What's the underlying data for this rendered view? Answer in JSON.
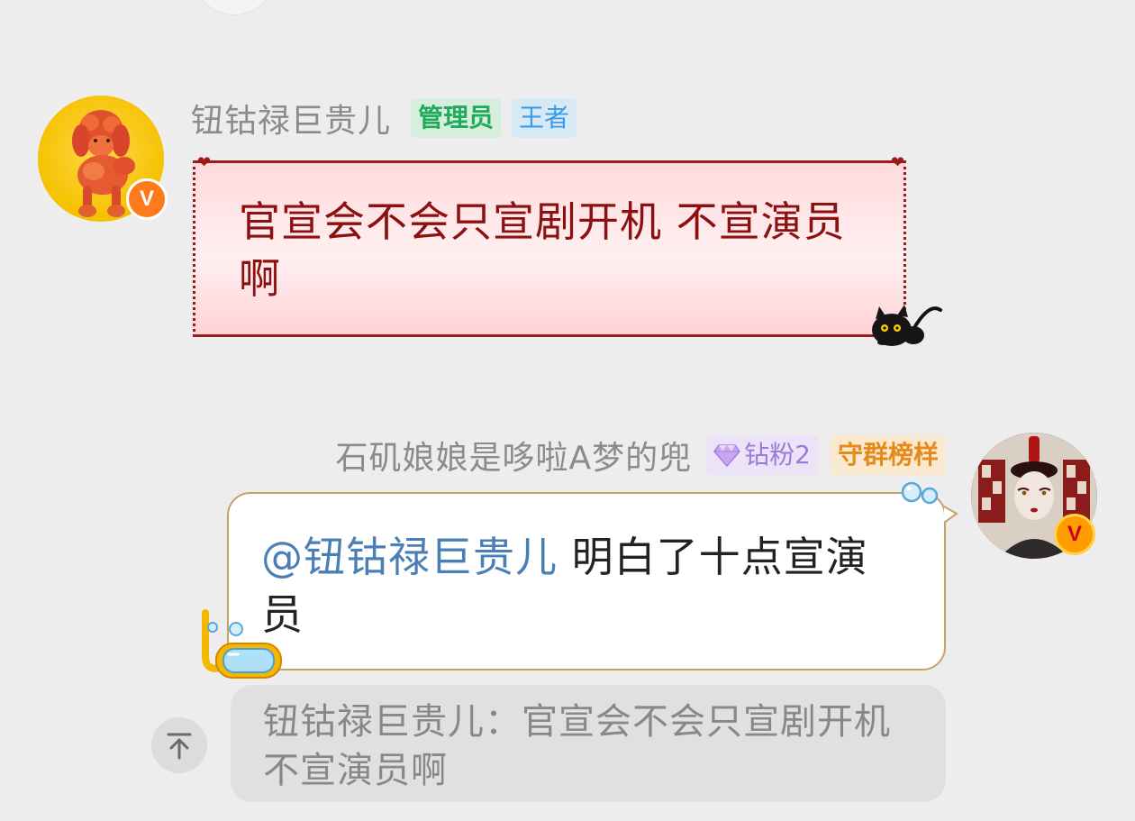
{
  "messages": [
    {
      "sender": "钮钴禄巨贵儿",
      "tags": [
        "管理员",
        "王者"
      ],
      "avatar_badge": "V",
      "text": "官宣会不会只宣剧开机 不宣演员啊",
      "bubble_style": "red-heart-frame-with-black-cat"
    },
    {
      "sender": "石矶娘娘是哆啦A梦的兜",
      "tags": [
        "钻粉2",
        "守群榜样"
      ],
      "avatar_badge": "V",
      "mention": "@钮钴禄巨贵儿",
      "text": " 明白了十点宣演员",
      "quote": "钮钴禄巨贵儿：官宣会不会只宣剧开机 不宣演员啊",
      "bubble_style": "white-ocean-goggles"
    }
  ],
  "icons": {
    "scroll_top": "arrow-up-to-top-icon",
    "diamond": "diamond-icon",
    "verified": "v-badge-icon"
  },
  "colors": {
    "background": "#ededed",
    "admin_tag": "#1faa5c",
    "king_tag": "#3a9be8",
    "diamond_tag": "#9b7bd8",
    "guard_tag": "#e48b1c",
    "mention": "#4a7fb6",
    "bubble1_text": "#8c1010"
  }
}
